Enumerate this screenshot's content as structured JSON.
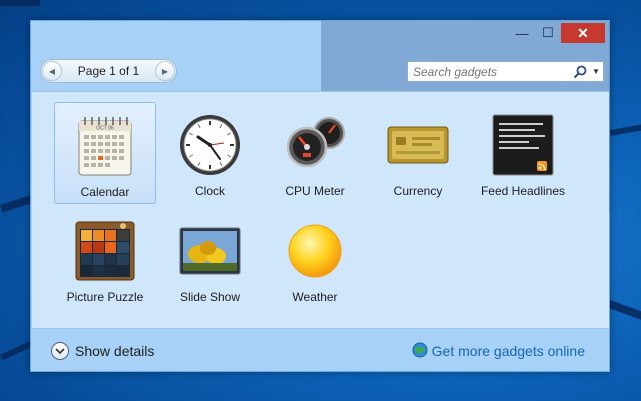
{
  "window": {
    "controls": {
      "minimize": "—",
      "maximize": "☐",
      "close": "✕"
    }
  },
  "pager": {
    "label": "Page 1 of 1",
    "prev": "◀",
    "next": "▶"
  },
  "search": {
    "placeholder": "Search gadgets",
    "dropdown": "▼"
  },
  "calendar_icon": {
    "month": "OCT 06"
  },
  "gadgets": [
    {
      "label": "Calendar",
      "icon": "calendar-icon",
      "selected": true
    },
    {
      "label": "Clock",
      "icon": "clock-icon"
    },
    {
      "label": "CPU Meter",
      "icon": "cpu-meter-icon"
    },
    {
      "label": "Currency",
      "icon": "currency-icon"
    },
    {
      "label": "Feed Headlines",
      "icon": "feed-headlines-icon"
    },
    {
      "label": "Picture Puzzle",
      "icon": "picture-puzzle-icon"
    },
    {
      "label": "Slide Show",
      "icon": "slide-show-icon"
    },
    {
      "label": "Weather",
      "icon": "weather-icon"
    }
  ],
  "footer": {
    "details_label": "Show details",
    "online_label": "Get more gadgets online"
  },
  "colors": {
    "window_bg": "#a8d1f7",
    "gallery_bg": "#cfe6fb",
    "close_red": "#c7392f",
    "link_blue": "#1565b8"
  }
}
